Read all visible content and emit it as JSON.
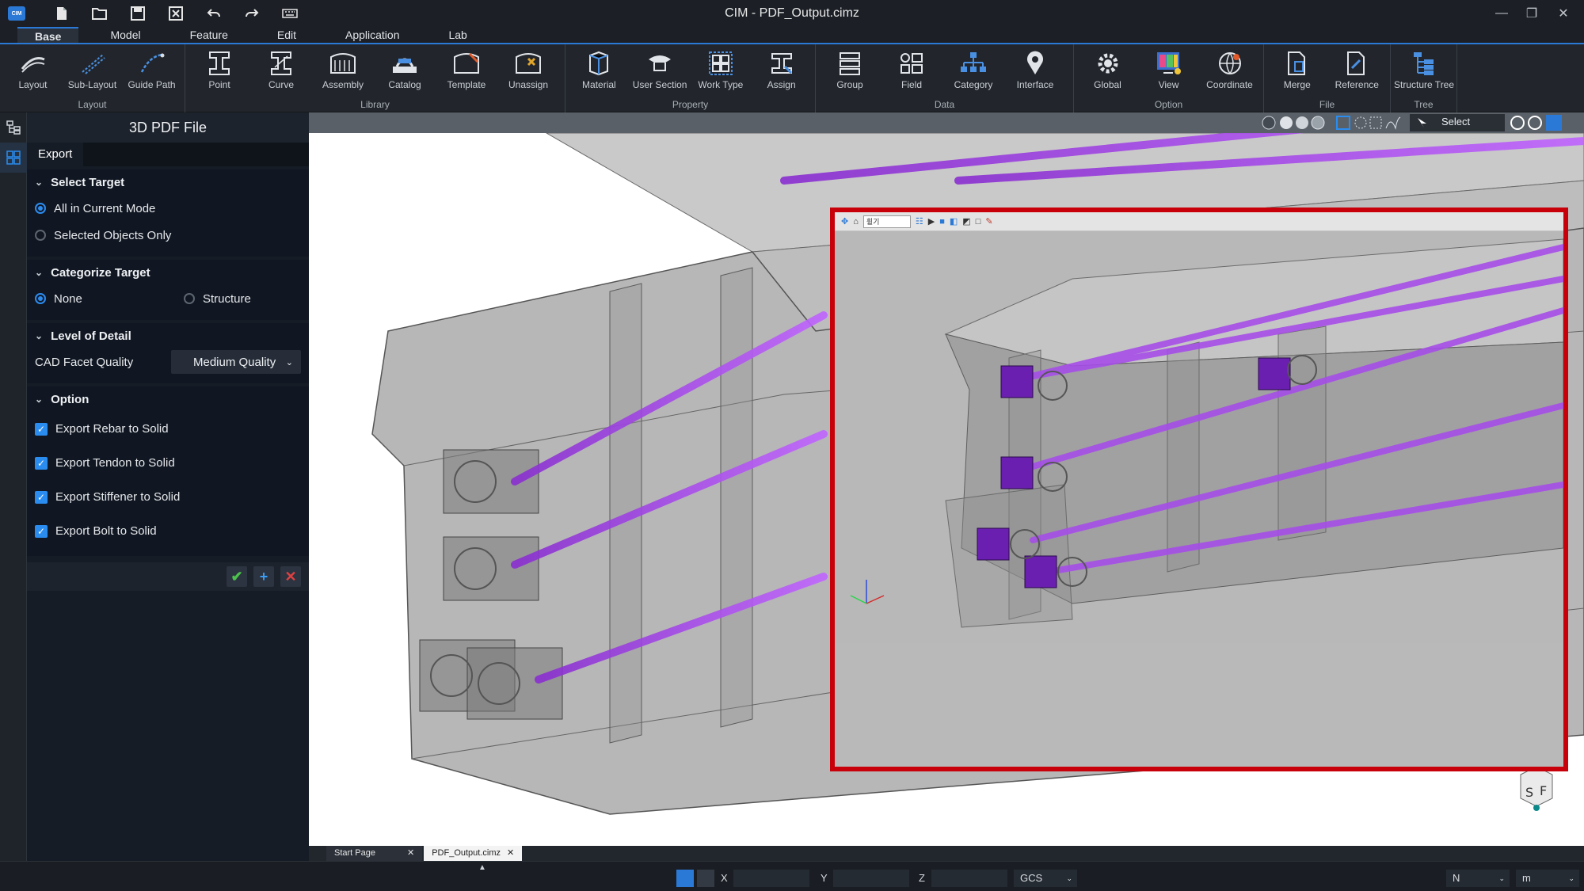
{
  "app": {
    "logo": "CIM",
    "title": "CIM - PDF_Output.cimz"
  },
  "quick_access": [
    "new-file-icon",
    "open-folder-icon",
    "save-icon",
    "close-file-icon",
    "undo-icon",
    "redo-icon",
    "keyboard-icon"
  ],
  "menu_tabs": [
    "Base",
    "Model",
    "Feature",
    "Edit",
    "Application",
    "Lab"
  ],
  "ribbon": {
    "groups": [
      {
        "title": "Layout",
        "items": [
          "Layout",
          "Sub-Layout",
          "Guide Path"
        ]
      },
      {
        "title": "Library",
        "items": [
          "Point",
          "Curve",
          "Assembly",
          "Catalog",
          "Template",
          "Unassign"
        ]
      },
      {
        "title": "Property",
        "items": [
          "Material",
          "User Section",
          "Work Type",
          "Assign"
        ]
      },
      {
        "title": "Data",
        "items": [
          "Group",
          "Field",
          "Category",
          "Interface"
        ]
      },
      {
        "title": "Option",
        "items": [
          "Global",
          "View",
          "Coordinate"
        ]
      },
      {
        "title": "File",
        "items": [
          "Merge",
          "Reference"
        ]
      },
      {
        "title": "Tree",
        "items": [
          "Structure Tree"
        ]
      }
    ]
  },
  "panel": {
    "title": "3D PDF File",
    "tab": "Export",
    "select_target": {
      "title": "Select Target",
      "options": [
        "All in Current Mode",
        "Selected Objects Only"
      ],
      "selected": "All in Current Mode"
    },
    "categorize_target": {
      "title": "Categorize Target",
      "options": [
        "None",
        "Structure"
      ],
      "selected": "None"
    },
    "level_of_detail": {
      "title": "Level of Detail",
      "label": "CAD Facet Quality",
      "value": "Medium Quality"
    },
    "option": {
      "title": "Option",
      "checks": [
        "Export Rebar to Solid",
        "Export Tendon to Solid",
        "Export Stiffener to Solid",
        "Export Bolt to Solid"
      ]
    },
    "actions": {
      "ok": "✔",
      "add": "+",
      "cancel": "✕"
    }
  },
  "view_toolbar": {
    "select_label": "Select"
  },
  "inset_toolbar": {
    "zoom_select": "휠기"
  },
  "doc_tabs": [
    {
      "label": "Start Page",
      "active": false
    },
    {
      "label": "PDF_Output.cimz",
      "active": true
    }
  ],
  "status": {
    "x_label": "X",
    "y_label": "Y",
    "z_label": "Z",
    "coord_system": "GCS",
    "direction": "N",
    "unit": "m"
  },
  "colors": {
    "accent": "#2b79d6",
    "tendon": "#9b3fe0",
    "highlight": "#c8000a"
  }
}
